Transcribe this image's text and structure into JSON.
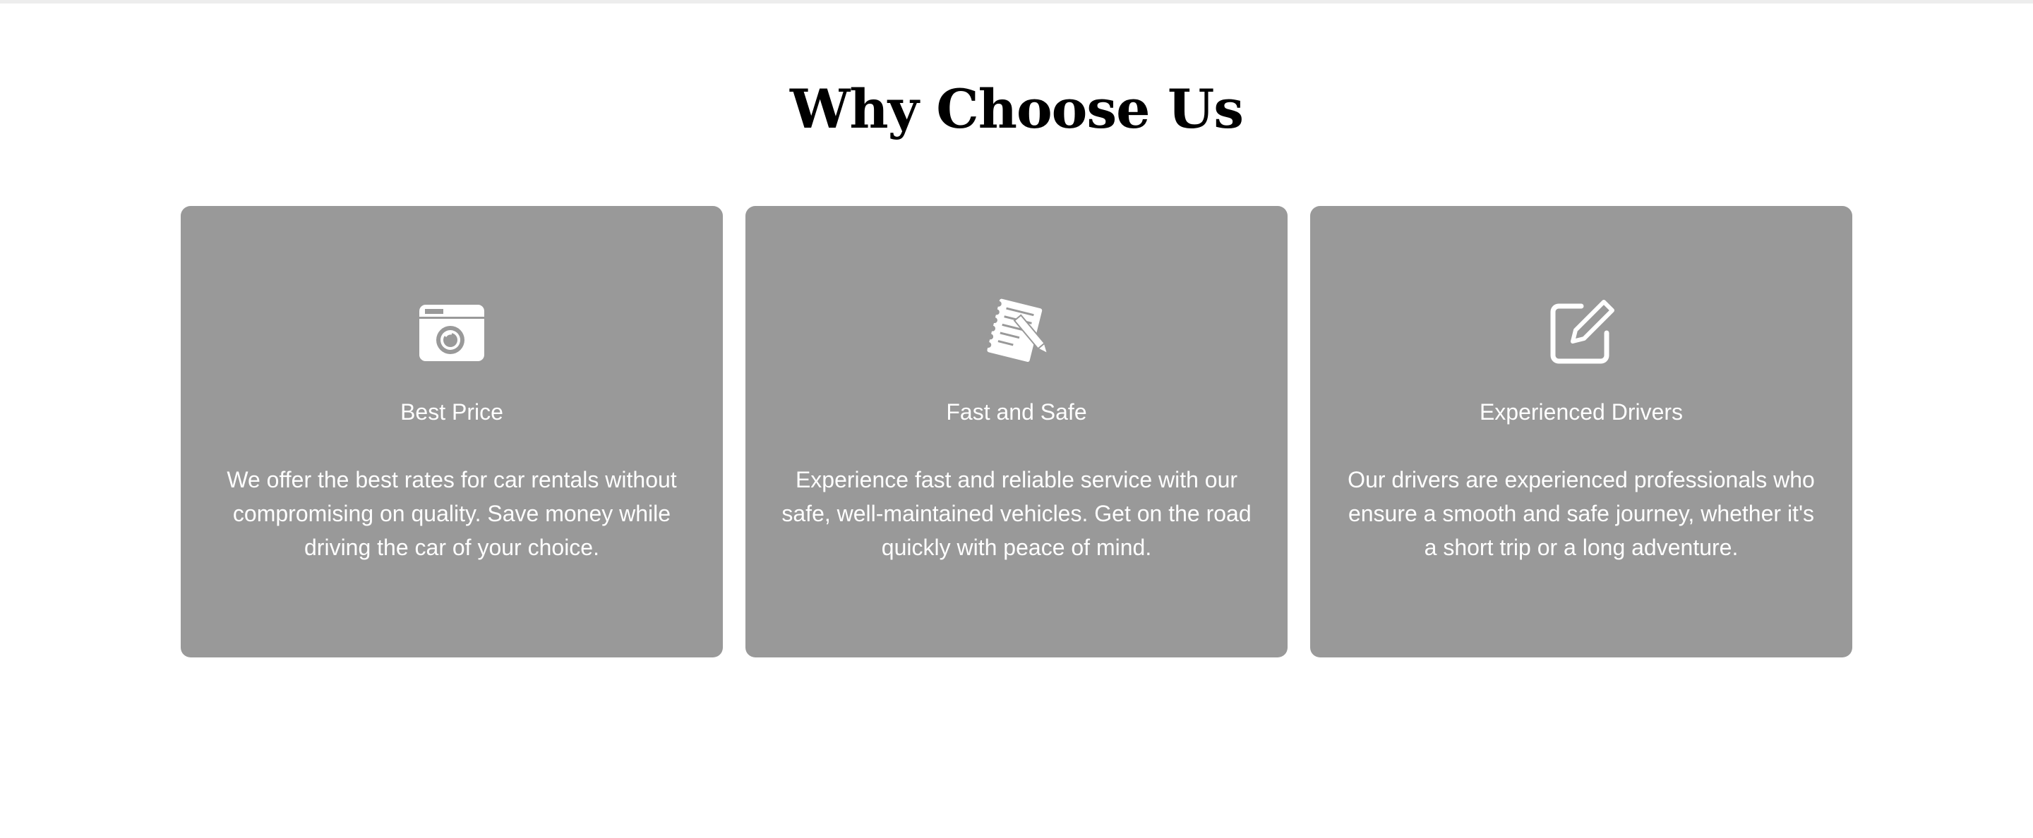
{
  "section": {
    "title": "Why Choose Us"
  },
  "colors": {
    "card_background": "#999999",
    "card_text": "#ffffff",
    "title": "#000000"
  },
  "features": [
    {
      "icon": "camera-icon",
      "title": "Best Price",
      "text": "We offer the best rates for car rentals without compromising on quality. Save money while driving the car of your choice."
    },
    {
      "icon": "notepad-pencil-icon",
      "title": "Fast and Safe",
      "text": "Experience fast and reliable service with our safe, well-maintained vehicles. Get on the road quickly with peace of mind."
    },
    {
      "icon": "edit-square-icon",
      "title": "Experienced Drivers",
      "text": "Our drivers are experienced professionals who ensure a smooth and safe journey, whether it's a short trip or a long adventure."
    }
  ]
}
